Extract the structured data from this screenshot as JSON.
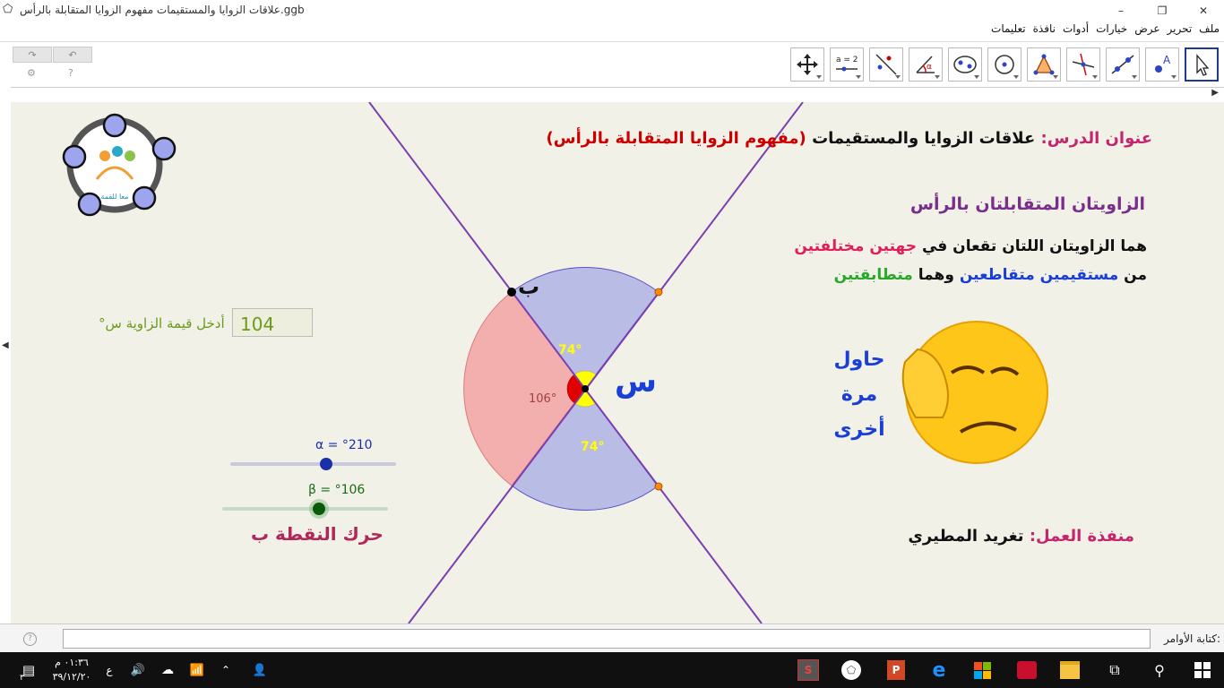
{
  "window": {
    "title": "علاقات الزوايا والمستقيمات مفهوم الزوايا المتقابلة بالرأس.ggb",
    "controls": [
      "–",
      "❐",
      "✕"
    ]
  },
  "menu": [
    "ملف",
    "تحرير",
    "عرض",
    "خيارات",
    "أدوات",
    "نافذة",
    "تعليمات"
  ],
  "toolbar": {
    "undo_icon": "undo-icon",
    "redo_icon": "redo-icon",
    "tools": [
      {
        "name": "move-tool",
        "icon": "cursor-arrow-icon",
        "selected": true
      },
      {
        "name": "point-tool",
        "icon": "point-a-icon",
        "label": "A"
      },
      {
        "name": "line-tool",
        "icon": "line-through-two-points-icon"
      },
      {
        "name": "perpendicular-tool",
        "icon": "perpendicular-line-icon"
      },
      {
        "name": "polygon-tool",
        "icon": "polygon-icon"
      },
      {
        "name": "circle-tool",
        "icon": "circle-center-point-icon"
      },
      {
        "name": "ellipse-tool",
        "icon": "ellipse-icon"
      },
      {
        "name": "angle-tool",
        "icon": "angle-icon",
        "label": "α"
      },
      {
        "name": "reflect-tool",
        "icon": "reflect-line-icon"
      },
      {
        "name": "slider-tool",
        "icon": "slider-icon",
        "label": "a = 2"
      },
      {
        "name": "move-view-tool",
        "icon": "move-graphics-view-icon"
      }
    ]
  },
  "canvas": {
    "lesson_label": "عنوان الدرس:",
    "lesson_title": "علاقات الزوايا والمستقيمات",
    "lesson_subtitle": "(مفهوم الزوايا المتقابلة بالرأس)",
    "heading": "الزاويتان المتقابلتان بالرأس",
    "def_line1_a": "هما الزاويتان اللتان تقعان في",
    "def_line1_b": "جهتين مختلفتين",
    "def_line2_a": "من",
    "def_line2_b": "مستقيمين متقاطعين",
    "def_line2_c": "وهما",
    "def_line2_d": "متطابقتين",
    "try_again": [
      "حاول",
      "مرة",
      "أخرى"
    ],
    "author_label": "منفذة العمل:",
    "author_name": "تغريد المطيري",
    "input_label": "أدخل قيمة الزاوية س",
    "input_value": "104",
    "input_unit": "°",
    "slider_alpha": "α = °210",
    "slider_beta": "β = °106",
    "slider_alpha_value": 210,
    "slider_beta_value": 106,
    "move_point_hint": "حرك النقطة ب",
    "point_label": "ب",
    "vertex_label": "س",
    "angle_top": "74°",
    "angle_bottom": "74°",
    "angle_left": "106°",
    "logo_text": "معا للقمة"
  },
  "command_bar": {
    "label": "كتابة الأوامر:",
    "placeholder": ""
  },
  "taskbar": {
    "time": "٠١:٣٦ م",
    "date": "٣٩/١٢/٢٠",
    "lang": "ع",
    "notification_count": "٣",
    "pinned": [
      "start-icon",
      "search-icon",
      "task-view-icon",
      "file-explorer-icon",
      "acrobat-icon",
      "store-icon",
      "edge-icon",
      "powerpoint-icon",
      "geogebra-icon",
      "snagit-icon"
    ]
  },
  "colors": {
    "canvas_bg": "#f1f1e8",
    "line": "#7a3fb0",
    "blue_sector": "#b9bde6",
    "red_sector": "#f3aeae",
    "yellow": "#ffff00",
    "red": "#e00000",
    "title_pink": "#c4266e",
    "heading_purple": "#7a2e8c",
    "word_red": "#e01e5a",
    "word_blue": "#1a3fd6",
    "word_green": "#2aa82a"
  }
}
